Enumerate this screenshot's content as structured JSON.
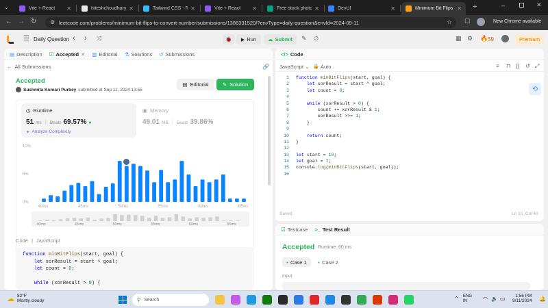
{
  "browser": {
    "tabs": [
      {
        "title": "Vite + React",
        "color": "#8b5cf6"
      },
      {
        "title": "hiteshchoudhary/Re...",
        "color": "#e6e6e6"
      },
      {
        "title": "Tailwind CSS - Rapid...",
        "color": "#38bdf8"
      },
      {
        "title": "Vite + React",
        "color": "#8b5cf6"
      },
      {
        "title": "Free stock photo of ...",
        "color": "#05a081"
      },
      {
        "title": "DevUI",
        "color": "#3b82f6"
      },
      {
        "title": "Minimum Bit Flips to...",
        "color": "#ffa116"
      }
    ],
    "url": "leetcode.com/problems/minimum-bit-flips-to-convert-number/submissions/1386331520/?envType=daily-question&envId=2024-09-11",
    "update_label": "New Chrome available"
  },
  "header": {
    "daily_question": "Daily Question",
    "run": "Run",
    "submit": "Submit",
    "streak": "59",
    "premium": "Premium"
  },
  "left_tabs": {
    "description": "Description",
    "accepted": "Accepted",
    "editorial": "Editorial",
    "solutions": "Solutions",
    "submissions": "Submissions"
  },
  "submission": {
    "back": "All Submissions",
    "status": "Accepted",
    "author": "Sushmita Kumari Purbey",
    "submitted": "submitted at Sep 11, 2024 13:55",
    "editorial_btn": "Editorial",
    "solution_btn": "Solution",
    "runtime_label": "Runtime",
    "runtime_value": "51",
    "runtime_unit": "ms",
    "runtime_beats_label": "Beats",
    "runtime_beats": "69.57%",
    "analyze": "Analyze Complexity",
    "memory_label": "Memory",
    "memory_value": "49.01",
    "memory_unit": "MB",
    "memory_beats_label": "Beats",
    "memory_beats": "39.86%"
  },
  "chart_data": {
    "type": "bar",
    "ylim": [
      0,
      10
    ],
    "yticks": [
      "10%",
      "5%",
      "0%"
    ],
    "xticks": [
      "40ms",
      "45ms",
      "50ms",
      "55ms",
      "60ms",
      "65ms"
    ],
    "values": [
      0.6,
      1.2,
      1.0,
      2.0,
      3.0,
      3.4,
      2.8,
      3.7,
      1.4,
      2.7,
      3.3,
      7.3,
      6.4,
      6.8,
      6.4,
      5.6,
      3.5,
      5.7,
      3.5,
      4.0,
      7.3,
      4.9,
      2.8,
      4.0,
      3.5,
      4.0,
      4.9,
      0.6,
      0.6,
      0.6
    ],
    "highlight_index": 12,
    "mini_xticks": [
      "40ms",
      "45ms",
      "50ms",
      "55ms",
      "60ms",
      "65ms"
    ]
  },
  "code_section": {
    "label": "Code",
    "lang": "JavaScript",
    "lines": [
      "function minBitFlips(start, goal) {",
      "    let xorResult = start ^ goal;",
      "    let count = 0;",
      "",
      "    while (xorResult > 0) {"
    ]
  },
  "editor": {
    "title": "Code",
    "lang": "JavaScript",
    "mode": "Auto",
    "lines": [
      "function minBitFlips(start, goal) {",
      "    let xorResult = start ^ goal;",
      "    let count = 0;",
      "",
      "    while (xorResult > 0) {",
      "        count += xorResult & 1;",
      "        xorResult >>= 1;",
      "    }",
      "",
      "    return count;",
      "}",
      "",
      "let start = 10;",
      "let goal = 7;",
      "console.log(minBitFlips(start, goal));",
      ""
    ],
    "saved": "Saved",
    "cursor": "Ln 15, Col 40"
  },
  "result": {
    "testcase_tab": "Testcase",
    "result_tab": "Test Result",
    "status": "Accepted",
    "runtime": "Runtime: 60 ms",
    "case1": "Case 1",
    "case2": "Case 2",
    "input_label": "Input"
  },
  "taskbar": {
    "temp": "82°F",
    "weather": "Mostly cloudy",
    "search": "Search",
    "lang": "ENG",
    "region": "IN",
    "time": "1:56 PM",
    "date": "9/11/2024"
  },
  "colors": {
    "accent_green": "#2db55d",
    "bar_blue": "#0a84ff",
    "leet_orange": "#ffa116"
  }
}
